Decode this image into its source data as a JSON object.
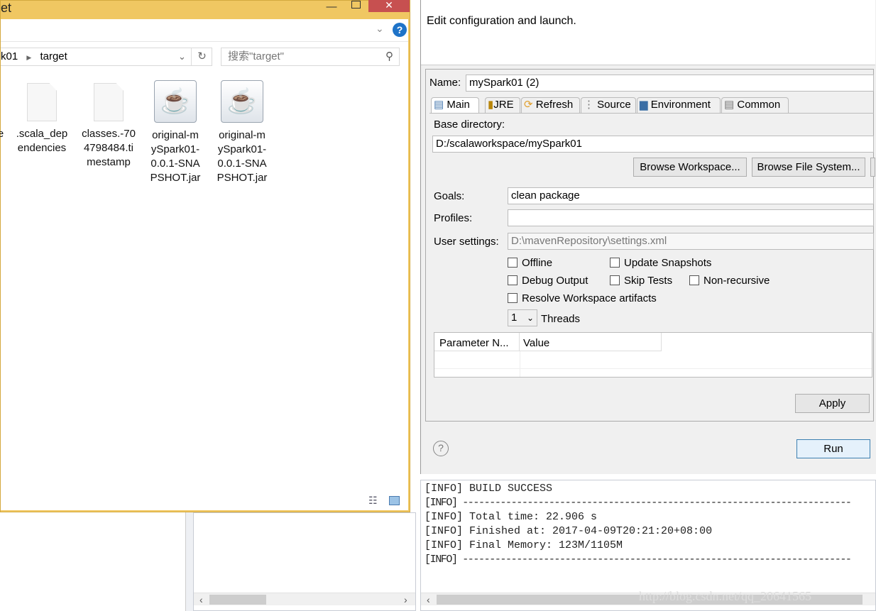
{
  "explorer": {
    "title_partial": "et",
    "minimize_icon": "minimize-icon",
    "maximize_icon": "maximize-icon",
    "close_icon": "close-icon",
    "help_label": "?",
    "address": {
      "crumb_prev": "k01",
      "crumb_current": "target"
    },
    "search_placeholder": "搜索\"target\"",
    "files": [
      {
        "name": "e",
        "type": "cut"
      },
      {
        "name": ".scala_dep endencies",
        "type": "file"
      },
      {
        "name": "classes.-70 4798484.ti mestamp",
        "type": "file"
      },
      {
        "name": "original-m ySpark01- 0.0.1-SNA PSHOT.jar",
        "type": "jar"
      },
      {
        "name": "original-m ySpark01- 0.0.1-SNA PSHOT.jar",
        "type": "jar"
      }
    ],
    "accent": "#f0c762"
  },
  "dialog": {
    "header": "Edit configuration and launch.",
    "name_label": "Name:",
    "name_value": "mySpark01 (2)",
    "tabs": [
      "Main",
      "JRE",
      "Refresh",
      "Source",
      "Environment",
      "Common"
    ],
    "base_dir_label": "Base directory:",
    "base_dir_value": "D:/scalaworkspace/mySpark01",
    "browse_workspace": "Browse Workspace...",
    "browse_fs": "Browse File System...",
    "goals_label": "Goals:",
    "goals_value": "clean package",
    "profiles_label": "Profiles:",
    "profiles_value": "",
    "user_settings_label": "User settings:",
    "user_settings_value": "D:\\mavenRepository\\settings.xml",
    "checkboxes": {
      "offline": "Offline",
      "update_snapshots": "Update Snapshots",
      "debug_output": "Debug Output",
      "skip_tests": "Skip Tests",
      "non_recursive": "Non-recursive",
      "resolve_workspace": "Resolve Workspace artifacts"
    },
    "threads_value": "1",
    "threads_label": "Threads",
    "table_headers": [
      "Parameter N...",
      "Value"
    ],
    "apply": "Apply",
    "run": "Run"
  },
  "console": {
    "lines": [
      "[INFO] BUILD SUCCESS",
      "[INFO] ------------------------------------------------------------------------",
      "[INFO] Total time: 22.906 s",
      "[INFO] Finished at: 2017-04-09T20:21:20+08:00",
      "[INFO] Final Memory: 123M/1105M",
      "[INFO] ------------------------------------------------------------------------"
    ]
  },
  "watermark": "http://blog.csdn.net/qq_20641565"
}
